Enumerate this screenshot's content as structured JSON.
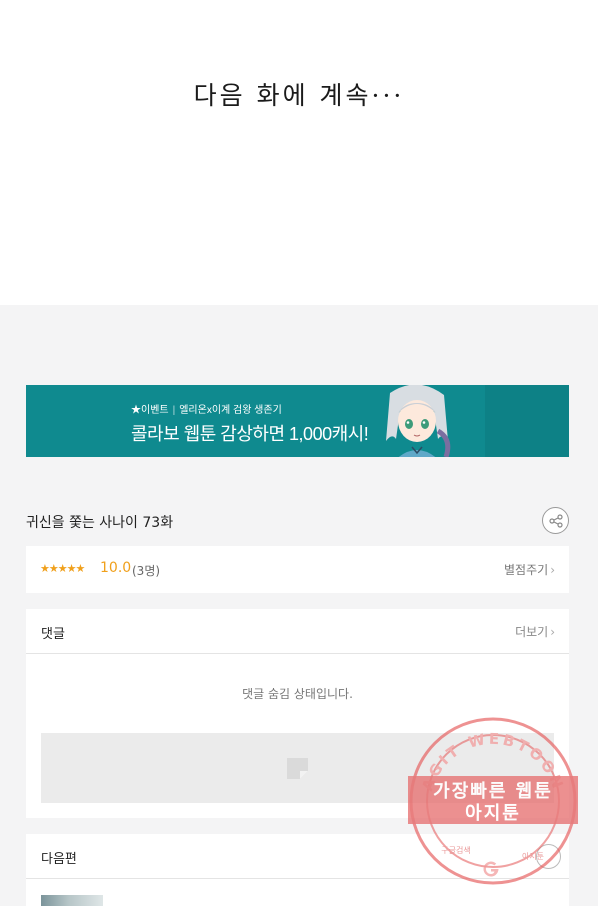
{
  "comic_end": {
    "text": "다음 화에 계속···"
  },
  "banner": {
    "small_event": "★이벤트",
    "small_desc": "엘리온x이계 검왕 생존기",
    "headline": "콜라보 웹툰 감상하면 1,000캐시!"
  },
  "episode": {
    "title": "귀신을 쫓는 사나이 73화",
    "share_icon": "share-icon"
  },
  "rating": {
    "stars": "★★★★★",
    "score": "10.0",
    "count": "(3명)",
    "rate_label": "별점주기",
    "chevron": "›"
  },
  "comments": {
    "heading": "댓글",
    "more_label": "더보기",
    "chevron": "›",
    "hidden_message": "댓글 숨김 상태입니다."
  },
  "next_episode": {
    "heading": "다음편"
  },
  "watermark": {
    "arc_text": "AGIT WEBTOON",
    "line1": "가장빠른 웹툰",
    "line2": "아지툰",
    "footer_left": "구글검색",
    "footer_right": "아지툰",
    "color": "#e55a5a"
  },
  "colors": {
    "banner_bg": "#0f8a8f",
    "accent_star": "#f0a01c",
    "page_bg": "#f4f4f5"
  }
}
